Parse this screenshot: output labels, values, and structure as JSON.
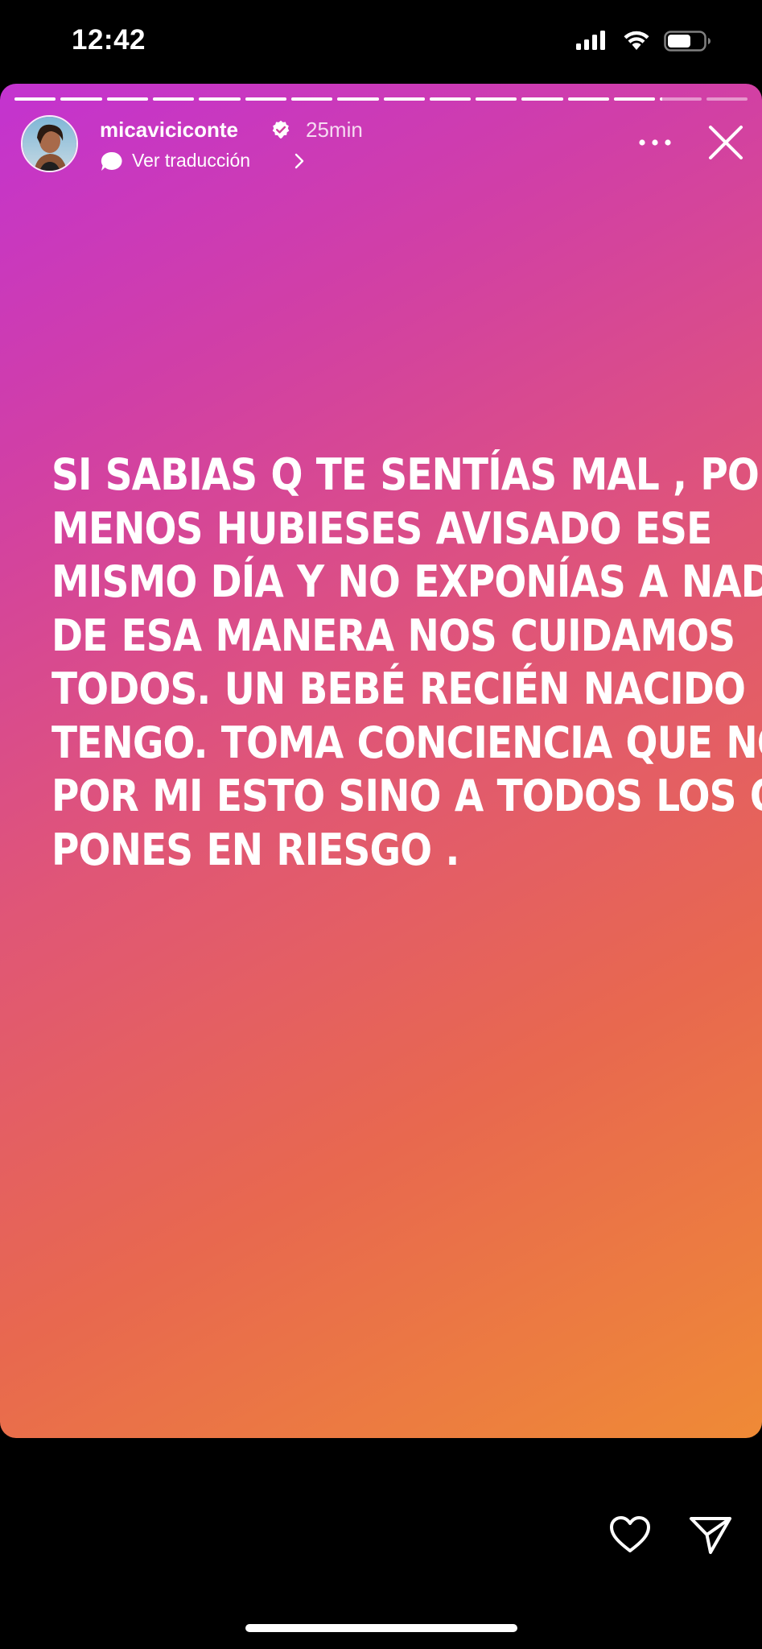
{
  "status_bar": {
    "time": "12:42",
    "icons": [
      "signal-icon",
      "wifi-icon",
      "battery-icon"
    ]
  },
  "story": {
    "total_segments": 16,
    "current_segment": 15,
    "current_segment_progress": 0.05,
    "username": "micaviciconte",
    "verified": true,
    "timestamp": "25min",
    "translate_label": "Ver traducción",
    "text_lines": [
      "SI SABIAS Q TE SENTÍAS MAL , POR LO",
      "MENOS HUBIESES AVISADO ESE",
      "MISMO DÍA Y NO EXPONÍAS A NADIE Y",
      "DE ESA MANERA NOS CUIDAMOS",
      "TODOS. UN BEBÉ RECIÉN NACIDO 👶",
      "TENGO. TOMA CONCIENCIA QUE NO ES",
      "POR MI ESTO SINO A TODOS LOS QUE",
      "PONES EN RIESGO ."
    ],
    "colors": {
      "gradient_start": "#c333d0",
      "gradient_mid": "#e05676",
      "gradient_end": "#ef8a36"
    }
  },
  "actions": {
    "icons": [
      "heart-icon",
      "send-icon"
    ]
  }
}
